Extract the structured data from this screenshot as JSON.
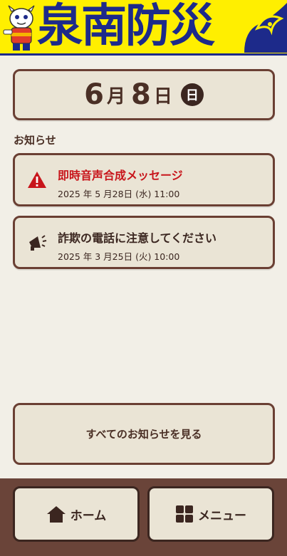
{
  "header": {
    "title": "泉南防災",
    "mascot_icon": "mascot-icon",
    "wave_icon": "wave-icon"
  },
  "date": {
    "month": "6",
    "month_unit": "月",
    "day": "8",
    "day_unit": "日",
    "weekday": "日"
  },
  "notices_section": {
    "label": "お知らせ",
    "items": [
      {
        "title": "即時音声合成メッセージ",
        "date": "2025 年 5 月28日 (水) 11:00",
        "icon": "warning-icon",
        "title_color": "#c8151b"
      },
      {
        "title": "詐欺の電話に注意してください",
        "date": "2025 年 3 月25日 (火) 10:00",
        "icon": "megaphone-icon",
        "title_color": "#3b2620"
      }
    ],
    "see_all_label": "すべてのお知らせを見る"
  },
  "footer": {
    "home_label": "ホーム",
    "home_icon": "home-icon",
    "menu_label": "メニュー",
    "menu_icon": "grid-menu-icon"
  },
  "colors": {
    "header_bg": "#ffef00",
    "header_text": "#1d2a8a",
    "card_bg": "#eae4d5",
    "card_border": "#6a3f33",
    "footer_bg": "#6a4439",
    "alert_red": "#c8151b"
  }
}
